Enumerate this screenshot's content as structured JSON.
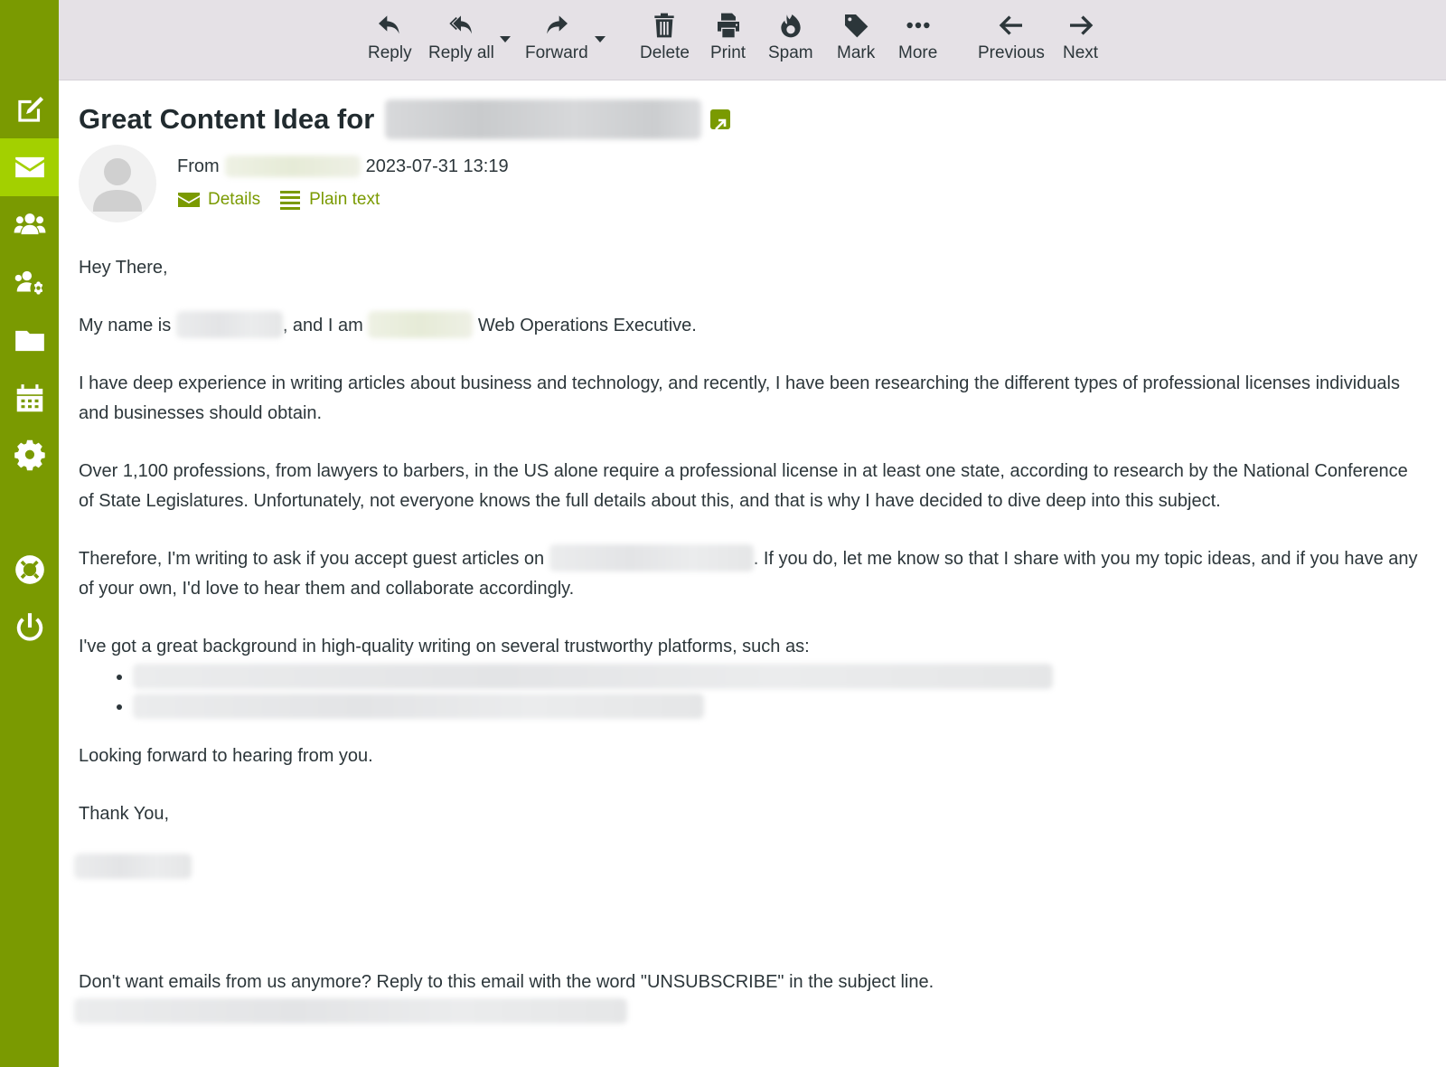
{
  "sidebar": {
    "items": [
      {
        "id": "compose",
        "icon": "compose-icon",
        "active": false
      },
      {
        "id": "mail",
        "icon": "envelope-icon",
        "active": true
      },
      {
        "id": "contacts",
        "icon": "users-icon",
        "active": false
      },
      {
        "id": "settings-users",
        "icon": "users-cog-icon",
        "active": false
      },
      {
        "id": "files",
        "icon": "folder-icon",
        "active": false
      },
      {
        "id": "calendar",
        "icon": "calendar-icon",
        "active": false
      },
      {
        "id": "settings",
        "icon": "gear-icon",
        "active": false
      },
      {
        "id": "help",
        "icon": "lifebuoy-icon",
        "active": false
      },
      {
        "id": "logout",
        "icon": "power-icon",
        "active": false
      }
    ]
  },
  "toolbar": {
    "reply": "Reply",
    "reply_all": "Reply all",
    "forward": "Forward",
    "delete": "Delete",
    "print": "Print",
    "spam": "Spam",
    "mark": "Mark",
    "more": "More",
    "previous": "Previous",
    "next": "Next"
  },
  "message": {
    "subject_prefix": "Great Content Idea for",
    "from_label": "From",
    "date": "2023-07-31 13:19",
    "details_label": "Details",
    "plain_text_label": "Plain text",
    "greeting": "Hey There,",
    "intro_part1": "My name is",
    "intro_part2": ", and I am",
    "intro_part3": "Web Operations Executive.",
    "para1": "I have deep experience in writing articles about business and technology, and recently, I have been researching the different types of professional licenses individuals and businesses should obtain.",
    "para2": "Over 1,100 professions, from lawyers to barbers, in the US alone require a professional license in at least one state, according to research by the National Conference of State Legislatures. Unfortunately, not everyone knows the full details about this, and that is why I have decided to dive deep into this subject.",
    "para3_part1": "Therefore, I'm writing to ask if you accept guest articles on",
    "para3_part2": ". If you do, let me know so that I share with you my topic ideas, and if you have any of your own, I'd love to hear them and collaborate accordingly.",
    "para4": "I've got a great background in high-quality writing on several trustworthy platforms, such as:",
    "closing": "Looking forward to hearing from you.",
    "signoff": "Thank You,",
    "unsubscribe": "Don't want emails from us anymore? Reply to this email with the word \"UNSUBSCRIBE\" in the subject line."
  },
  "colors": {
    "brand": "#7a9a01",
    "active": "#a3d000",
    "toolbar_bg": "#e5e1e6"
  }
}
